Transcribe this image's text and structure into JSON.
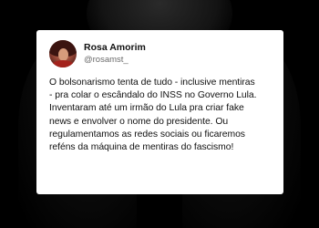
{
  "post": {
    "author_name": "Rosa Amorim",
    "author_handle": "@rosamst_",
    "lines": [
      "O bolsonarismo tenta de tudo - inclusive mentiras",
      "- pra colar o escândalo do INSS no Governo Lula.",
      "Inventaram até um irmão do Lula pra criar fake",
      "news e envolver o nome do presidente. Ou",
      "regulamentamos as redes sociais ou ficaremos",
      "reféns da máquina de mentiras do fascismo!"
    ]
  },
  "colors": {
    "background": "#000000",
    "card": "#ffffff",
    "text": "#111111",
    "handle": "#6b6b6b"
  },
  "icons": {
    "avatar": "profile-photo"
  }
}
